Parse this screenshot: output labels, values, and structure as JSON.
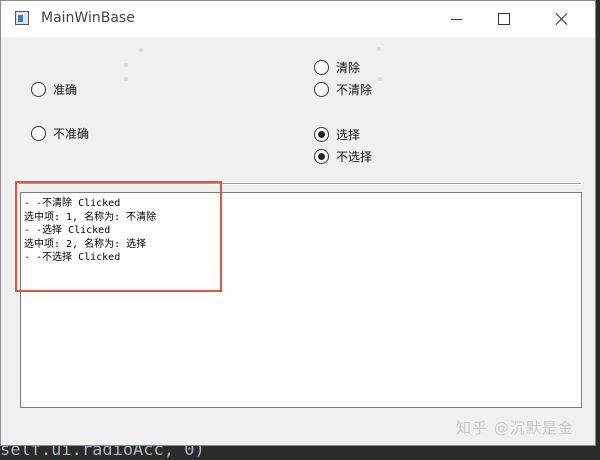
{
  "window": {
    "title": "MainWinBase"
  },
  "radios": {
    "accurate": {
      "label": "准确",
      "checked": false
    },
    "inaccurate": {
      "label": "不准确",
      "checked": false
    },
    "clear": {
      "label": "清除",
      "checked": false
    },
    "no_clear": {
      "label": "不清除",
      "checked": false
    },
    "select": {
      "label": "选择",
      "checked": true
    },
    "no_select": {
      "label": "不选择",
      "checked": true
    }
  },
  "log": {
    "lines": [
      "- -不清除 Clicked",
      "选中项: 1, 名称为: 不清除",
      "- -选择 Clicked",
      "选中项: 2, 名称为: 选择",
      "- -不选择 Clicked"
    ]
  },
  "watermark": "知乎 @沉默是金",
  "editor_fragment": "self.ui.radioAcc, 0)",
  "colors": {
    "highlight": "#e0553f"
  }
}
